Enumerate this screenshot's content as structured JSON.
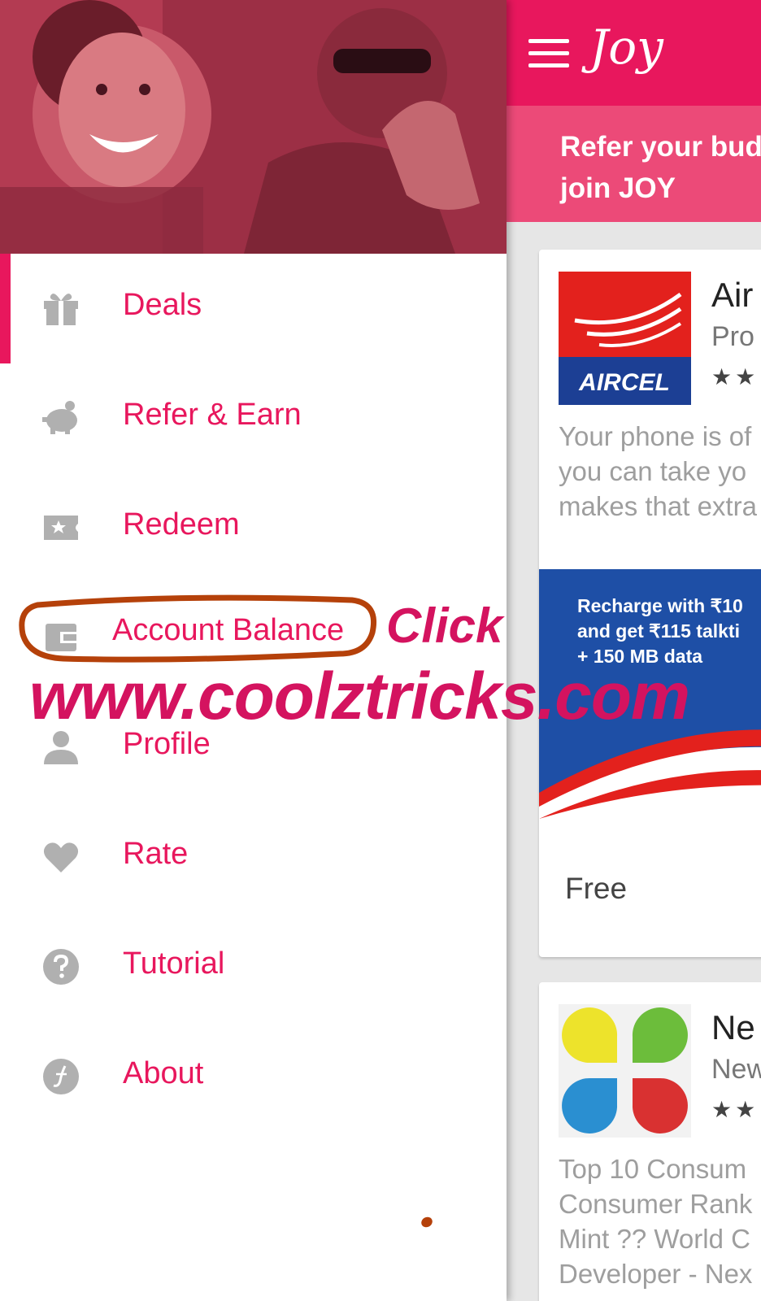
{
  "app": {
    "title": "Joy",
    "refer_banner": "Refer your buddies to join JOY",
    "refer_banner_lines": [
      "Refer your bud",
      "join JOY"
    ]
  },
  "cards": [
    {
      "logo_text": "AIRCEL",
      "title": "Air",
      "subtitle": "Pro",
      "stars": "★★",
      "description": "Your phone is of\nyou can take yo\nmakes that extra",
      "promo_text": "Recharge with ₹10\nand get ₹115 talkti\n+ 150 MB data",
      "price": "Free"
    },
    {
      "title": "Ne",
      "subtitle": "New",
      "stars": "★★",
      "description": "Top 10 Consum\nConsumer Rank\nMint ?? World C\nDeveloper - Nex"
    }
  ],
  "drawer": {
    "items": [
      {
        "label": "Deals",
        "icon": "gift-icon",
        "active": true
      },
      {
        "label": "Refer & Earn",
        "icon": "piggy-bank-icon"
      },
      {
        "label": "Redeem",
        "icon": "ticket-icon"
      },
      {
        "label": "Account Balance",
        "icon": "wallet-icon"
      },
      {
        "label": "Profile",
        "icon": "person-icon"
      },
      {
        "label": "Rate",
        "icon": "heart-icon"
      },
      {
        "label": "Tutorial",
        "icon": "help-icon"
      },
      {
        "label": "About",
        "icon": "joy-logo-icon"
      }
    ]
  },
  "annotation": {
    "click_label": "Click",
    "watermark": "www.coolztricks.com"
  },
  "colors": {
    "accent": "#e8175d",
    "banner": "#ec4a78",
    "annotation_stroke": "#b5410a",
    "icon_gray": "#b0b0b0"
  }
}
